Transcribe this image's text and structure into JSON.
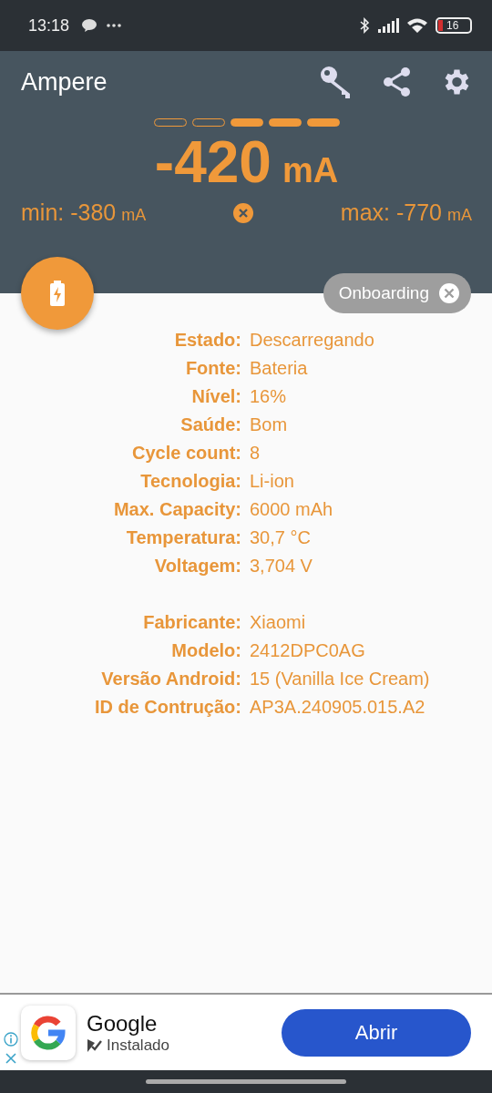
{
  "status_bar": {
    "time": "13:18",
    "battery": "16"
  },
  "app_bar": {
    "title": "Ampere"
  },
  "meter": {
    "segments": [
      {
        "filled": false
      },
      {
        "filled": false
      },
      {
        "filled": true
      },
      {
        "filled": true
      },
      {
        "filled": true
      }
    ],
    "value": "-420",
    "unit": "mA"
  },
  "min": {
    "label": "min: -380",
    "unit": "mA"
  },
  "max": {
    "label": "max: -770",
    "unit": "mA"
  },
  "chip": {
    "label": "Onboarding"
  },
  "info_groups": [
    [
      {
        "label": "Estado:",
        "value": "Descarregando"
      },
      {
        "label": "Fonte:",
        "value": "Bateria"
      },
      {
        "label": "Nível:",
        "value": "16%"
      },
      {
        "label": "Saúde:",
        "value": "Bom"
      },
      {
        "label": "Cycle count:",
        "value": "8"
      },
      {
        "label": "Tecnologia:",
        "value": "Li-ion"
      },
      {
        "label": "Max. Capacity:",
        "value": "6000 mAh"
      },
      {
        "label": "Temperatura:",
        "value": "30,7 °C"
      },
      {
        "label": "Voltagem:",
        "value": "3,704 V"
      }
    ],
    [
      {
        "label": "Fabricante:",
        "value": "Xiaomi"
      },
      {
        "label": "Modelo:",
        "value": "2412DPC0AG"
      },
      {
        "label": "Versão Android:",
        "value": "15 (Vanilla Ice Cream)"
      },
      {
        "label": "ID de Contrução:",
        "value": "AP3A.240905.015.A2"
      }
    ]
  ],
  "ad": {
    "name": "Google",
    "status": "Instalado",
    "button": "Abrir"
  }
}
